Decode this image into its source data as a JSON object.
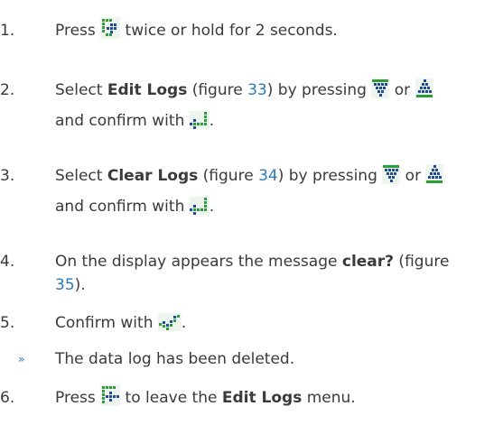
{
  "steps": [
    {
      "number": "1.",
      "parts": {
        "a": "Press ",
        "b": " twice or hold for 2 seconds."
      },
      "icons": [
        "menu-key-icon"
      ]
    },
    {
      "number": "2.",
      "parts": {
        "a": "Select ",
        "bold": "Edit Logs",
        "c": " (figure ",
        "fig": "33",
        "d": ") by pressing ",
        "e": " or ",
        "f": "and confirm with ",
        "g": "."
      },
      "icons": [
        "down-arrow-key-icon",
        "up-arrow-key-icon",
        "enter-key-icon"
      ]
    },
    {
      "number": "3.",
      "parts": {
        "a": "Select ",
        "bold": "Clear Logs",
        "c": " (figure ",
        "fig": "34",
        "d": ") by pressing ",
        "e": " or ",
        "f": "and confirm with ",
        "g": "."
      },
      "icons": [
        "down-arrow-key-icon",
        "up-arrow-key-icon",
        "enter-key-icon"
      ]
    },
    {
      "number": "4.",
      "parts": {
        "a": "On the display appears the message ",
        "bold": "clear?",
        "c": " (figure",
        "fig": "35",
        "d": ")."
      }
    },
    {
      "number": "5.",
      "parts": {
        "a": "Confirm with ",
        "b": "."
      },
      "icons": [
        "checkmark-key-icon"
      ]
    },
    {
      "bullet": "»",
      "text": "The data log has been deleted."
    },
    {
      "number": "6.",
      "parts": {
        "a": "Press ",
        "b": " to leave the ",
        "bold": "Edit Logs",
        "c": " menu."
      },
      "icons": [
        "exit-key-icon"
      ]
    }
  ],
  "colors": {
    "text": "#3a3a3a",
    "link": "#2a7ab8",
    "icon_green": "#2e9a3a",
    "icon_blue": "#1f4a9a"
  }
}
